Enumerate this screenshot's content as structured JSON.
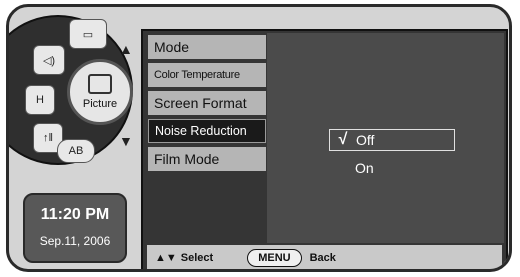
{
  "controls": {
    "center_label": "Picture",
    "ab_label": "AB"
  },
  "clock": {
    "time": "11:20 PM",
    "date": "Sep.11, 2006"
  },
  "menu": {
    "items": [
      {
        "label": "Mode"
      },
      {
        "label": "Color Temperature"
      },
      {
        "label": "Screen Format"
      },
      {
        "label": "Noise Reduction"
      },
      {
        "label": "Film Mode"
      }
    ]
  },
  "options": {
    "items": [
      {
        "label": "Off",
        "checked": true
      },
      {
        "label": "On",
        "checked": false
      }
    ],
    "check_glyph": "√"
  },
  "bottom_bar": {
    "select_glyph": "▲▼",
    "select_label": "Select",
    "menu_label": "MENU",
    "back_label": "Back"
  }
}
